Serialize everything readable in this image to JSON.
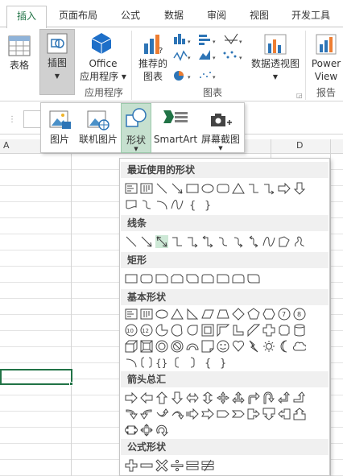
{
  "tabs": [
    {
      "label": "插入",
      "active": true
    },
    {
      "label": "页面布局"
    },
    {
      "label": "公式"
    },
    {
      "label": "数据"
    },
    {
      "label": "审阅"
    },
    {
      "label": "视图"
    },
    {
      "label": "开发工具"
    }
  ],
  "ribbon": {
    "table_label": "表格",
    "illustrations_label": "插图",
    "office_label_1": "Office",
    "office_label_2": "应用程序",
    "apps_group": "应用程序",
    "recommended_charts_1": "推荐的",
    "recommended_charts_2": "图表",
    "pivot_chart": "数据透视图",
    "power_view_1": "Power",
    "power_view_2": "View",
    "charts_group": "图表",
    "reports_group": "报告"
  },
  "sheet": {
    "col_a": "A",
    "col_d": "D"
  },
  "gallery": {
    "picture": "图片",
    "online_picture": "联机图片",
    "shapes": "形状",
    "smartart": "SmartArt",
    "screenshot": "屏幕截图"
  },
  "shapes_menu": {
    "recent": "最近使用的形状",
    "lines": "线条",
    "rectangles": "矩形",
    "basic": "基本形状",
    "arrows": "箭头总汇",
    "equation": "公式形状"
  },
  "colors": {
    "accent": "#217346",
    "highlight": "#cde8d6"
  }
}
